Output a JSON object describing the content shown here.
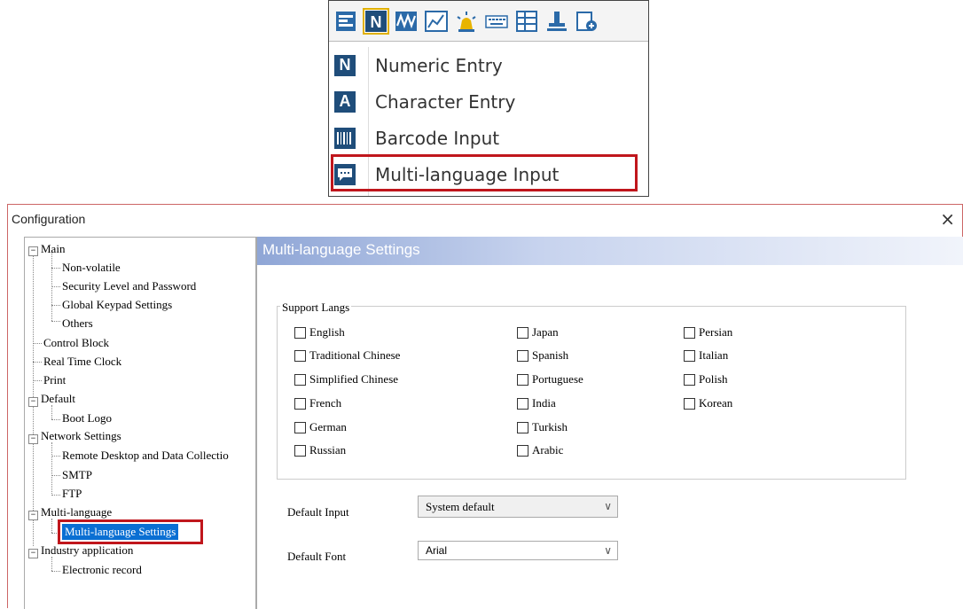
{
  "toolbar": {
    "icons": [
      "table-icon",
      "numeric-n-icon",
      "waveform-icon",
      "chart-icon",
      "alarm-light-icon",
      "keyboard-icon",
      "grid-icon",
      "pin-icon",
      "add-page-icon"
    ]
  },
  "menu": {
    "items": [
      {
        "icon_letter": "N",
        "label": "Numeric Entry"
      },
      {
        "icon_letter": "A",
        "label": "Character Entry"
      },
      {
        "icon_letter": "",
        "label": "Barcode Input"
      },
      {
        "icon_letter": "",
        "label": "Multi-language Input"
      }
    ]
  },
  "dialog": {
    "title": "Configuration",
    "close": "×",
    "tree": {
      "main": "Main",
      "non_volatile": "Non-volatile",
      "security": "Security Level and Password",
      "global_keypad": "Global Keypad Settings",
      "others": "Others",
      "control_block": "Control Block",
      "rtc": "Real Time Clock",
      "print": "Print",
      "default": "Default",
      "boot_logo": "Boot Logo",
      "network": "Network Settings",
      "remote_desktop": "Remote Desktop and Data Collectio",
      "smtp": "SMTP",
      "ftp": "FTP",
      "multi_language": "Multi-language",
      "ml_settings": "Multi-language Settings",
      "industry": "Industry application",
      "electronic_record": "Electronic record",
      "expander_minus": "−"
    },
    "panel": {
      "title": "Multi-language Settings",
      "support_langs": "Support Langs",
      "langs": {
        "col1": [
          "English",
          "Traditional Chinese",
          "Simplified Chinese",
          "French",
          "German",
          "Russian"
        ],
        "col2": [
          "Japan",
          "Spanish",
          "Portuguese",
          "India",
          "Turkish",
          "Arabic"
        ],
        "col3": [
          "Persian",
          "Italian",
          "Polish",
          "Korean"
        ]
      },
      "default_input_label": "Default Input",
      "default_input_value": "System default",
      "default_font_label": "Default Font",
      "default_font_value": "Arial",
      "dropdown_arrow": "∨"
    }
  },
  "colors": {
    "highlight_red": "#c0161c",
    "selection_blue": "#0a6fd3",
    "menu_icon_blue": "#1f4d7a"
  }
}
